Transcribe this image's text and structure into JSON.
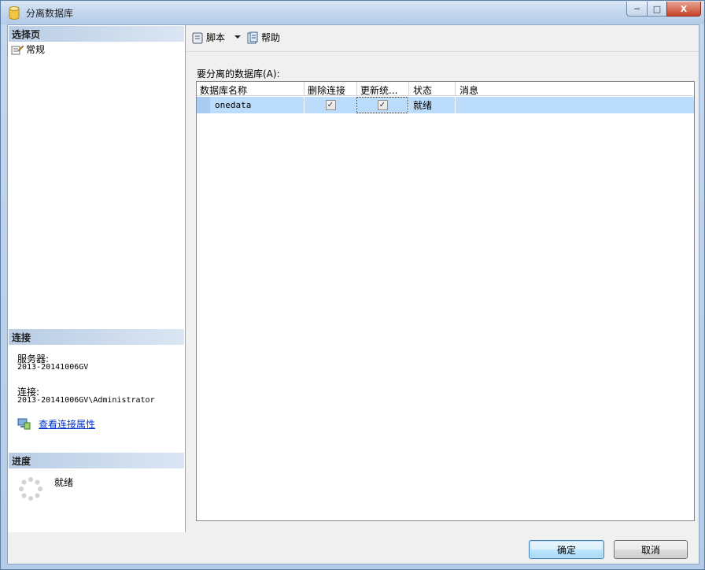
{
  "window": {
    "title": "分离数据库",
    "min_glyph": "─",
    "max_glyph": "□",
    "close_glyph": "X"
  },
  "left_pane": {
    "select_page_header": "选择页",
    "pages": [
      {
        "label": "常规",
        "icon": "page-general-icon"
      }
    ],
    "connection_header": "连接",
    "server_label": "服务器:",
    "server_value": "2013-20141006GV",
    "connection_label": "连接:",
    "connection_value": "2013-20141006GV\\Administrator",
    "view_props_link": "查看连接属性",
    "progress_header": "进度",
    "progress_status": "就绪"
  },
  "toolbar": {
    "script_label": "脚本",
    "help_label": "帮助"
  },
  "grid": {
    "label": "要分离的数据库(A):",
    "columns": [
      "数据库名称",
      "删除连接",
      "更新统...",
      "状态",
      "消息"
    ],
    "rows": [
      {
        "name": "onedata",
        "drop_connections": true,
        "update_stats": true,
        "status": "就绪",
        "message": ""
      }
    ]
  },
  "footer": {
    "ok_label": "确定",
    "cancel_label": "取消"
  },
  "colors": {
    "selected_row": "#bcdcfb",
    "section_header": "#b9cde5",
    "link": "#0033cc"
  }
}
